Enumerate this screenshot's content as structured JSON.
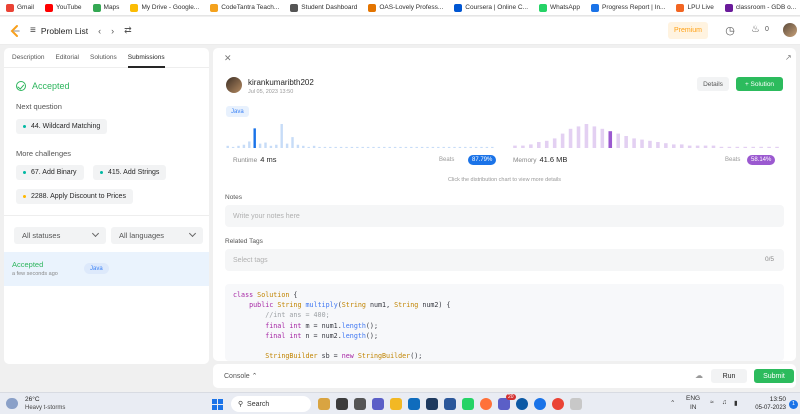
{
  "bookmarks": [
    {
      "label": "Gmail",
      "color": "#ea4335"
    },
    {
      "label": "YouTube",
      "color": "#ff0000"
    },
    {
      "label": "Maps",
      "color": "#34a853"
    },
    {
      "label": "My Drive - Google...",
      "color": "#fbbc04"
    },
    {
      "label": "CodeTantra Teach...",
      "color": "#f4a21d"
    },
    {
      "label": "Student Dashboard",
      "color": "#555555"
    },
    {
      "label": "OAS-Lovely Profess...",
      "color": "#e37400"
    },
    {
      "label": "Coursera | Online C...",
      "color": "#0056d2"
    },
    {
      "label": "WhatsApp",
      "color": "#25d366"
    },
    {
      "label": "Progress Report | In...",
      "color": "#1a73e8"
    },
    {
      "label": "LPU Live",
      "color": "#f26522"
    },
    {
      "label": "classroom - GDB o...",
      "color": "#6a1b9a"
    }
  ],
  "topnav": {
    "problem_list": "Problem List",
    "premium": "Premium",
    "streak": "0"
  },
  "left": {
    "tabs": [
      "Description",
      "Editorial",
      "Solutions",
      "Submissions"
    ],
    "status": "Accepted",
    "next_question_label": "Next question",
    "next_question": "44. Wildcard Matching",
    "more_challenges_label": "More challenges",
    "challenges": [
      {
        "label": "67. Add Binary",
        "dot": "#00b8a3"
      },
      {
        "label": "415. Add Strings",
        "dot": "#00b8a3"
      },
      {
        "label": "2288. Apply Discount to Prices",
        "dot": "#ffb800"
      }
    ],
    "filter_status": "All statuses",
    "filter_language": "All languages",
    "submission": {
      "status": "Accepted",
      "time": "a few seconds ago",
      "lang": "Java"
    }
  },
  "detail": {
    "username": "kirankumaribth202",
    "date": "Jul 05, 2023 13:50",
    "details_label": "Details",
    "solution_label": "+ Solution",
    "language": "Java",
    "runtime_label": "Runtime",
    "runtime_value": "4 ms",
    "runtime_beats_label": "Beats",
    "runtime_beats": "87.79%",
    "memory_label": "Memory",
    "memory_value": "41.6 MB",
    "memory_beats_label": "Beats",
    "memory_beats": "58.14%",
    "dist_hint": "Click the distribution chart to view more details",
    "notes_label": "Notes",
    "notes_placeholder": "Write your notes here",
    "tags_label": "Related Tags",
    "tags_placeholder": "Select tags",
    "tags_count": "0/5",
    "runtime_bars": [
      2,
      1,
      2,
      3,
      6,
      18,
      4,
      5,
      2,
      3,
      22,
      4,
      10,
      3,
      2,
      1,
      2,
      1,
      1,
      1,
      1,
      1,
      1,
      1,
      1,
      1,
      1,
      1,
      1,
      1,
      1,
      1,
      1,
      1,
      1,
      1,
      1,
      1,
      1,
      1,
      1,
      1,
      1,
      1,
      1,
      1,
      1,
      1,
      1,
      1
    ],
    "runtime_highlight": 5,
    "memory_bars": [
      2,
      2,
      3,
      5,
      6,
      8,
      12,
      16,
      18,
      20,
      18,
      16,
      14,
      12,
      10,
      8,
      7,
      6,
      5,
      4,
      3,
      3,
      2,
      2,
      2,
      2,
      1,
      1,
      1,
      1,
      1,
      1,
      1,
      1
    ],
    "memory_highlight": 12
  },
  "console": {
    "label": "Console",
    "run": "Run",
    "submit": "Submit"
  },
  "taskbar": {
    "temp": "26°C",
    "weather": "Heavy t-storms",
    "search": "Search",
    "lang": "ENG",
    "region": "IN",
    "time": "13:50",
    "date": "05-07-2023",
    "notifications": "1",
    "badge": "20"
  }
}
